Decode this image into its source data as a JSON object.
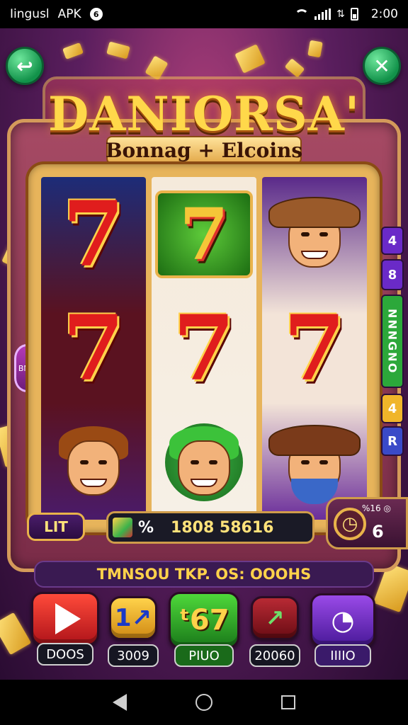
{
  "status_bar": {
    "left_text": "Iingusl",
    "app_text": "APK",
    "notification_icon": "notification-dot-icon",
    "time": "2:00",
    "icons": [
      "wifi-icon",
      "signal-icon",
      "data-icon",
      "battery-icon"
    ]
  },
  "game": {
    "title": "DANIORSA'",
    "subtitle": "Bonnag + Elcoins",
    "corner_left_icon": "back-arrow-icon",
    "corner_right_icon": "close-icon",
    "reels": [
      {
        "symbols": [
          "seven",
          "seven",
          "character-face"
        ]
      },
      {
        "symbols": [
          "seven-green-tile",
          "seven",
          "character-face"
        ]
      },
      {
        "symbols": [
          "character-face",
          "seven",
          "character-face"
        ]
      }
    ],
    "left_badge": "BNG",
    "side_pills": [
      "4",
      "8",
      "NNNGNO",
      "4",
      "R"
    ],
    "lit_button": "LIT",
    "balance": {
      "percent": "%",
      "value": "1808 58616"
    },
    "timer": {
      "top_label": "%16 ◎",
      "value": "6"
    },
    "ticker": "TMNSOU TKP. OS: OOOHS",
    "actions": [
      {
        "name": "play",
        "label": "DOOS",
        "color": "#e0242a"
      },
      {
        "name": "one",
        "label": "3009",
        "color": "#f0b52a"
      },
      {
        "name": "middle",
        "label": "PIUO",
        "color": "#2f9e2a"
      },
      {
        "name": "arrow",
        "label": "20060",
        "color": "#8c1a24"
      },
      {
        "name": "clock",
        "label": "IIIIO",
        "color": "#7a2ac8"
      }
    ],
    "accent_gold": "#ffd84a"
  },
  "nav_bar": {
    "icons": [
      "back-icon",
      "home-icon",
      "recent-apps-icon"
    ]
  }
}
